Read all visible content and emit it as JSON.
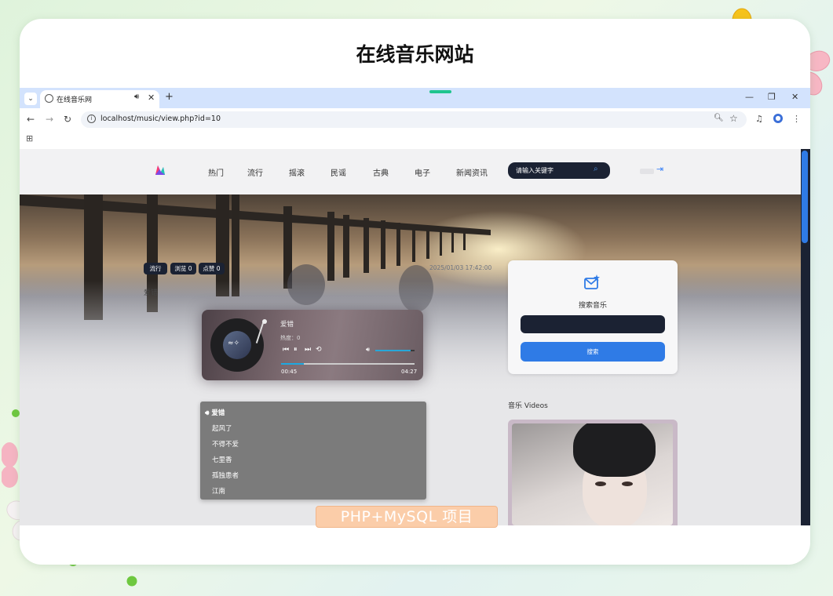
{
  "card": {
    "title": "在线音乐网站"
  },
  "browser": {
    "tab_title": "在线音乐网",
    "url": "localhost/music/view.php?id=10",
    "icons": [
      "menu-chevron-icon",
      "globe-icon",
      "speaker-icon",
      "close-icon",
      "plus-icon",
      "minimize-icon",
      "restore-icon",
      "back-icon",
      "forward-icon",
      "reload-icon",
      "zoom-icon",
      "star-icon",
      "media-icon",
      "profile-icon",
      "more-icon",
      "apps-grid-icon"
    ]
  },
  "site": {
    "nav": [
      "热门",
      "流行",
      "摇滚",
      "民谣",
      "古典",
      "电子",
      "新闻资讯"
    ],
    "search_placeholder": "请输入关键字",
    "tags": [
      "流行",
      "浏览 0",
      "点赞 0"
    ],
    "date": "2025/01/03 17:42:00",
    "song_heading": "爱错",
    "player": {
      "title": "爱错",
      "heat": "热度：0",
      "current_time": "00:45",
      "duration": "04:27",
      "progress": 0.17,
      "volume": 0.9
    },
    "playlist": [
      "爱错",
      "起风了",
      "不得不爱",
      "七里香",
      "孤独患者",
      "江南"
    ],
    "sidebar": {
      "search_label": "搜索音乐",
      "search_button": "搜索",
      "videos_heading": "音乐 Videos"
    },
    "colors": {
      "dark": "#1b2233",
      "accent": "#2f7be6",
      "playlist_bg": "#7b7b7b"
    }
  },
  "footer": {
    "badge": "PHP+MySQL 项目"
  }
}
